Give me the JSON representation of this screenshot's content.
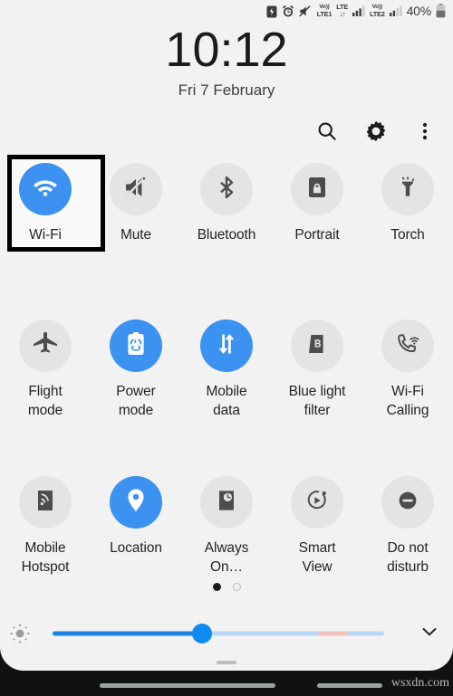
{
  "status_bar": {
    "icons": [
      "battery-saver-icon",
      "alarm-icon",
      "mute-icon",
      "volte-lte1-icon",
      "lte-data-icon",
      "signal-1-icon",
      "volte-lte2-icon",
      "signal-2-icon"
    ],
    "volte_label_top": "Vo))",
    "volte_sim1_label": "LTE1",
    "volte_sim2_label": "LTE2",
    "lte_label": "LTE",
    "battery_percent": "40%"
  },
  "clock": {
    "time": "10:12",
    "date": "Fri 7 February"
  },
  "header_actions": [
    {
      "name": "search-button",
      "icon": "search-icon"
    },
    {
      "name": "settings-button",
      "icon": "gear-icon"
    },
    {
      "name": "more-options-button",
      "icon": "overflow-menu-icon"
    }
  ],
  "tiles": [
    [
      {
        "label": "Wi-Fi",
        "icon": "wifi-icon",
        "active": true,
        "selected": true
      },
      {
        "label": "Mute",
        "icon": "mute-icon",
        "active": false,
        "selected": false
      },
      {
        "label": "Bluetooth",
        "icon": "bluetooth-icon",
        "active": false,
        "selected": false
      },
      {
        "label": "Portrait",
        "icon": "rotation-lock-icon",
        "active": false,
        "selected": false
      },
      {
        "label": "Torch",
        "icon": "flashlight-icon",
        "active": false,
        "selected": false
      }
    ],
    [
      {
        "label": "Flight\nmode",
        "icon": "airplane-icon",
        "active": false,
        "selected": false
      },
      {
        "label": "Power\nmode",
        "icon": "power-saving-icon",
        "active": true,
        "selected": false
      },
      {
        "label": "Mobile\ndata",
        "icon": "mobile-data-icon",
        "active": true,
        "selected": false
      },
      {
        "label": "Blue light\nfilter",
        "icon": "blue-light-filter-icon",
        "active": false,
        "selected": false
      },
      {
        "label": "Wi-Fi\nCalling",
        "icon": "wifi-calling-icon",
        "active": false,
        "selected": false
      }
    ],
    [
      {
        "label": "Mobile\nHotspot",
        "icon": "hotspot-icon",
        "active": false,
        "selected": false
      },
      {
        "label": "Location",
        "icon": "location-pin-icon",
        "active": true,
        "selected": false
      },
      {
        "label": "Always\nOn…",
        "icon": "always-on-display-icon",
        "active": false,
        "selected": false
      },
      {
        "label": "Smart\nView",
        "icon": "smart-view-icon",
        "active": false,
        "selected": false
      },
      {
        "label": "Do not\ndisturb",
        "icon": "do-not-disturb-icon",
        "active": false,
        "selected": false
      }
    ]
  ],
  "pagination": {
    "pages": 2,
    "active_index": 0
  },
  "brightness": {
    "icon": "brightness-icon",
    "value_percent": 45,
    "warm_start_percent": 80,
    "warm_end_percent": 89,
    "expand_icon": "chevron-down-icon"
  },
  "panel_handle": "drag-handle",
  "navigation_bar": {
    "buttons": [
      "recents-button",
      "home-button",
      "back-button"
    ],
    "watermark": "wsxdn.com"
  },
  "colors": {
    "accent_on": "#3b92f0",
    "tile_off": "#e4e4e4",
    "panel_bg": "#f2f2f2",
    "slider_fill": "#1a84e0",
    "slider_track": "#b8d8f7",
    "slider_warm": "#f4c3bc",
    "text_primary": "#242424"
  }
}
